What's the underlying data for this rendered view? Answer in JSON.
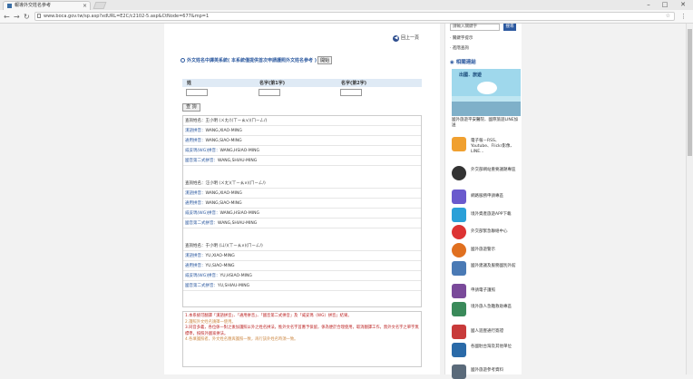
{
  "browser": {
    "tab_title": "報導外交姓名參考",
    "tab_close": "×",
    "url": "www.boca.gov.tw/sp.asp?xdURL=E2C/c2102-5.asp&CtNode=677&mp=1",
    "window_controls": [
      "–",
      "□",
      "✕"
    ]
  },
  "page": {
    "back_link": "回上一頁",
    "heading": "外文姓名中譯英系統( 本系統僅提供首次申請護照外文姓名參考 )",
    "heading_button": "開始",
    "form": {
      "col1": "姓",
      "col2": "名字(第1字)",
      "col3": "名字(第2字)",
      "query_button": "查 詢"
    },
    "results": [
      {
        "chinese_label": "查詢姓名：",
        "chinese_name": "王小明 (ㄨㄤ/)(ㄒㄧㄠ∨)(ㄇㄧㄥ/)",
        "rows": [
          {
            "label": "漢語拼音：",
            "value": "WANG,XIAO-MING"
          },
          {
            "label": "通用拼音：",
            "value": "WANG,SIAO-MING"
          },
          {
            "label": "威妥瑪(WG)拼音：",
            "value": "WANG,HSIAO-MING"
          },
          {
            "label": "國音第二式拼音：",
            "value": "WANG,SHIAU-MING"
          }
        ]
      },
      {
        "chinese_label": "查詢姓名：",
        "chinese_name": "汪小明 (ㄨㄤ)(ㄒㄧㄠ∨)(ㄇㄧㄥ/)",
        "rows": [
          {
            "label": "漢語拼音：",
            "value": "WANG,XIAO-MING"
          },
          {
            "label": "通用拼音：",
            "value": "WANG,SIAO-MING"
          },
          {
            "label": "威妥瑪(WG)拼音：",
            "value": "WANG,HSIAO-MING"
          },
          {
            "label": "國音第二式拼音：",
            "value": "WANG,SHIAU-MING"
          }
        ]
      },
      {
        "chinese_label": "查詢姓名：",
        "chinese_name": "于小明 (ㄩ/)(ㄒㄧㄠ∨)(ㄇㄧㄥ/)",
        "rows": [
          {
            "label": "漢語拼音：",
            "value": "YU,XIAO-MING"
          },
          {
            "label": "通用拼音：",
            "value": "YU,SIAO-MING"
          },
          {
            "label": "威妥瑪(WG)拼音：",
            "value": "YU,HSIAO-MING"
          },
          {
            "label": "國音第二式拼音：",
            "value": "YU,SHIAU-MING"
          }
        ]
      }
    ],
    "notes": [
      "1.本系統可翻譯「漢語拼音」、「通用拼音」、「國音第二式拼音」及「威妥瑪（WG）拼音」結果。",
      "2.護照外文姓名請擇一使用。",
      "3.同音多義，各位係一對之後加護照以外之姓名拼法，惟外文名字首應予保留，係為便於合理使用，取消翻譯工作，無外文名字之單字無標準，按照外國家拼法。",
      "4.各填護照者，外文姓名應與護照一致，再行該外姓名時須一致。"
    ]
  },
  "sidebar": {
    "search_placeholder": "請輸入關鍵字",
    "search_button": "搜尋",
    "links": [
      "‧ 關鍵字提示",
      "‧ 進階查詢"
    ],
    "section_title": "相關連結",
    "banner_caption": "出國．旅遊",
    "items": [
      "國外旅遊平安醫院、國際旅遊LINE加送",
      "電子報－RSS、Youtube、Flickr影像、LINE...",
      "外交部網站重要議題專區",
      "網路服務申請專區",
      "境外資產旅遊APP下載",
      "外交部緊急聯絡中心",
      "國外旅遊警示",
      "國外建議及服務國別外館",
      "申請電子護照",
      "境外旅人急難救助專區",
      "國人遊歷通行簽證",
      "各國駐台灣及其他單位",
      "國外旅遊參考資料"
    ]
  }
}
